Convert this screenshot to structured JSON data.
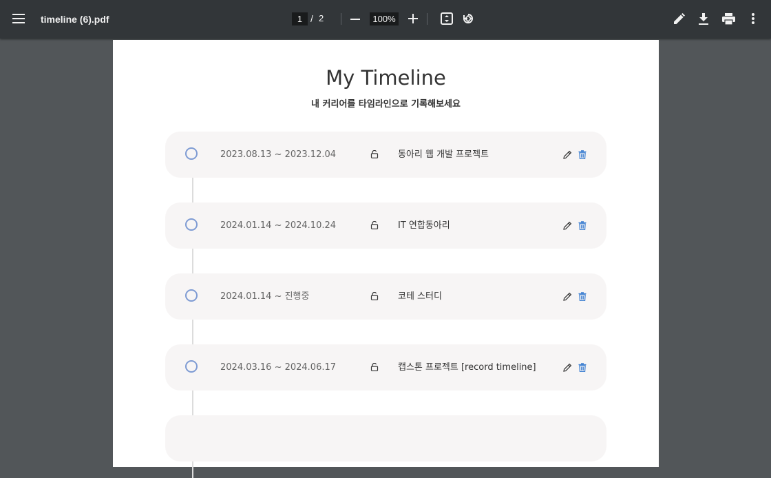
{
  "toolbar": {
    "menu_icon": "hamburger-menu-icon",
    "file_name": "timeline (6).pdf",
    "current_page": "1",
    "page_separator": "/",
    "total_pages": "2",
    "zoom": "100%",
    "icons": [
      "minus-icon",
      "plus-icon",
      "fit-page-icon",
      "rotate-icon",
      "pencil-icon",
      "download-icon",
      "print-icon",
      "more-vert-icon"
    ]
  },
  "document": {
    "title": "My Timeline",
    "subtitle": "내 커리어를 타임라인으로 기록해보세요",
    "entries": [
      {
        "date": "2023.08.13 ~ 2023.12.04",
        "title": "동아리 웹 개발 프로젝트"
      },
      {
        "date": "2024.01.14 ~ 2024.10.24",
        "title": "IT 연합동아리"
      },
      {
        "date": "2024.01.14 ~ 진행중",
        "title": "코테 스터디"
      },
      {
        "date": "2024.03.16 ~ 2024.06.17",
        "title": "캡스톤 프로젝트 [record timeline]"
      },
      {
        "date": "",
        "title": ""
      }
    ]
  },
  "colors": {
    "toolbar_bg": "#323639",
    "viewer_bg": "#525659",
    "card_bg": "#f7f5f5",
    "timeline_dot": "#7e9bd3",
    "delete_icon": "#3d7fd1"
  }
}
